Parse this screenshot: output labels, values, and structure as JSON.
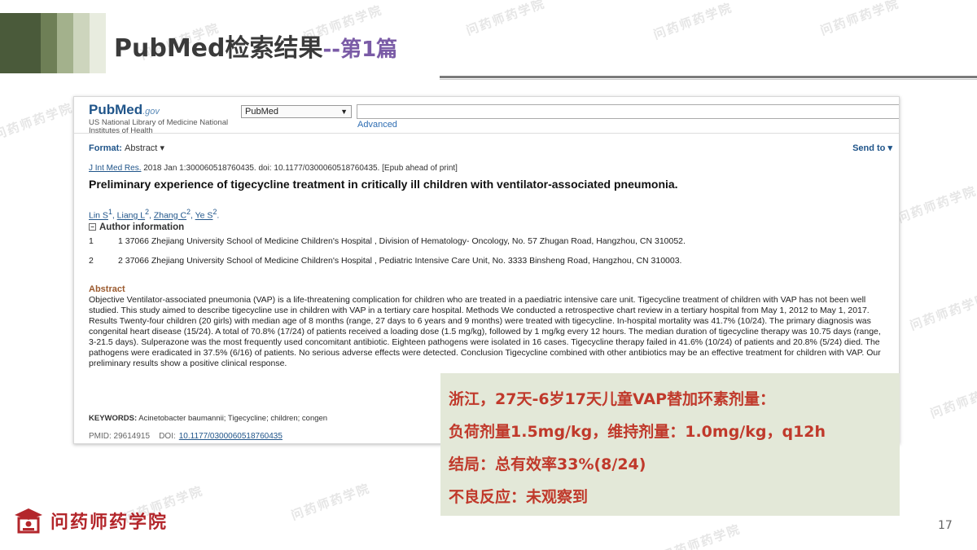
{
  "slide": {
    "title_main": "PubMed检索结果",
    "title_sep": "--",
    "title_sub": "第1篇",
    "page_number": "17",
    "brand_name": "问药师药学院",
    "watermark": "问药师药学院",
    "header_colors": [
      "#4a5a3a",
      "#6e7f56",
      "#a3b18c",
      "#cdd5bd",
      "#e8ecdf"
    ]
  },
  "pubmed": {
    "logo_text": "PubMed",
    "logo_suffix": ".gov",
    "library_text": "US National Library of Medicine National Institutes of Health",
    "db_select": "PubMed",
    "advanced_link": "Advanced",
    "format_label": "Format:",
    "format_value": "Abstract",
    "send_to": "Send to",
    "citation_journal": "J Int Med Res.",
    "citation_rest": " 2018 Jan 1:300060518760435. doi: 10.1177/0300060518760435. [Epub ahead of print]",
    "article_title": "Preliminary experience of tigecycline treatment in critically ill children with ventilator-associated pneumonia.",
    "authors": [
      {
        "name": "Lin S",
        "aff": "1"
      },
      {
        "name": "Liang L",
        "aff": "2"
      },
      {
        "name": "Zhang C",
        "aff": "2"
      },
      {
        "name": "Ye S",
        "aff": "2"
      }
    ],
    "author_info_label": "Author information",
    "affiliations": [
      {
        "num": "1",
        "text": "1 37066 Zhejiang University School of Medicine Children's Hospital , Division of Hematology- Oncology, No. 57 Zhugan Road, Hangzhou, CN 310052."
      },
      {
        "num": "2",
        "text": "2 37066 Zhejiang University School of Medicine Children's Hospital , Pediatric Intensive Care Unit, No. 3333 Binsheng Road, Hangzhou, CN 310003."
      }
    ],
    "abstract_label": "Abstract",
    "abstract_text": "Objective Ventilator-associated pneumonia (VAP) is a life-threatening complication for children who are treated in a paediatric intensive care unit. Tigecycline treatment of children with VAP has not been well studied. This study aimed to describe tigecycline use in children with VAP in a tertiary care hospital. Methods We conducted a retrospective chart review in a tertiary hospital from May 1, 2012 to May 1, 2017. Results Twenty-four children (20 girls) with median age of 8 months (range, 27 days to 6 years and 9 months) were treated with tigecycline. In-hospital mortality was 41.7% (10/24). The primary diagnosis was congenital heart disease (15/24). A total of 70.8% (17/24) of patients received a loading dose (1.5 mg/kg), followed by 1 mg/kg every 12 hours. The median duration of tigecycline therapy was 10.75 days (range, 3-21.5 days). Sulperazone was the most frequently used concomitant antibiotic. Eighteen pathogens were isolated in 16 cases. Tigecycline therapy failed in 41.6% (10/24) of patients and 20.8% (5/24) died. The pathogens were eradicated in 37.5% (6/16) of patients. No serious adverse effects were detected. Conclusion Tigecycline combined with other antibiotics may be an effective treatment for children with VAP. Our preliminary results show a positive clinical response.",
    "keywords_label": "KEYWORDS:",
    "keywords_text": " Acinetobacter baumannii; Tigecycline; children; congen",
    "pmid": "PMID: 29614915",
    "doi_label": "DOI:",
    "doi_link": "10.1177/0300060518760435"
  },
  "callout": {
    "line1": "浙江，27天-6岁17天儿童VAP替加环素剂量：",
    "line2": "负荷剂量1.5mg/kg，维持剂量：1.0mg/kg，q12h",
    "line3": "结局：总有效率33%(8/24)",
    "line4": "不良反应：未观察到"
  }
}
